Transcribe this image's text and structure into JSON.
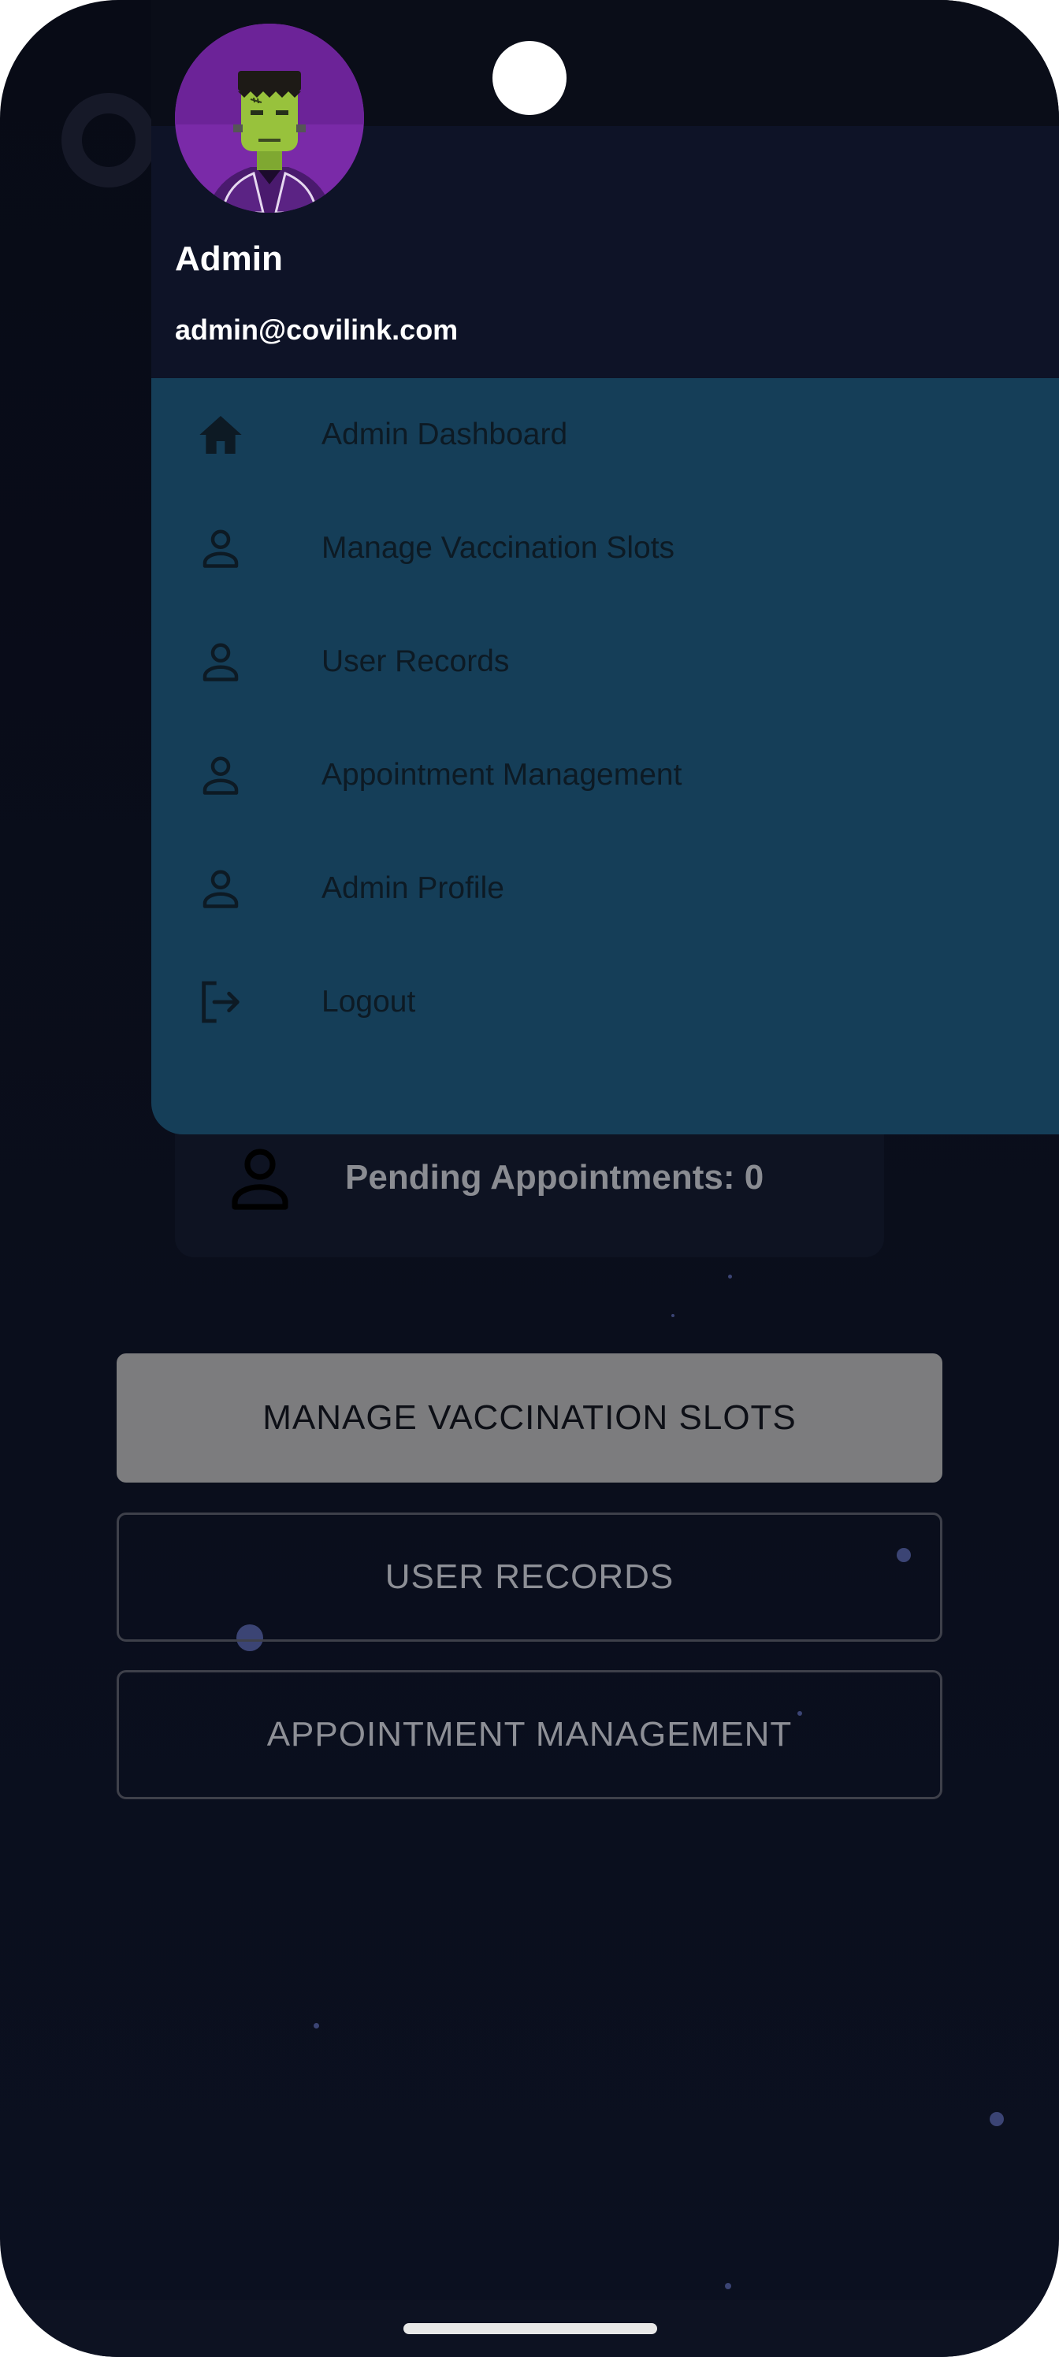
{
  "drawer": {
    "user": {
      "name": "Admin",
      "email": "admin@covilink.com",
      "avatar_icon": "frankenstein-avatar-icon"
    },
    "menu": [
      {
        "label": "Admin Dashboard",
        "icon": "home-icon"
      },
      {
        "label": "Manage Vaccination Slots",
        "icon": "person-icon"
      },
      {
        "label": "User Records",
        "icon": "person-icon"
      },
      {
        "label": "Appointment Management",
        "icon": "person-icon"
      },
      {
        "label": "Admin Profile",
        "icon": "person-icon"
      },
      {
        "label": "Logout",
        "icon": "logout-icon"
      }
    ]
  },
  "main": {
    "pending_label": "Pending Appointments: 0",
    "buttons": {
      "manage_slots": "MANAGE VACCINATION SLOTS",
      "user_records": "USER RECORDS",
      "appointment_management": "APPOINTMENT MANAGEMENT"
    }
  },
  "colors": {
    "background": "#080b16",
    "drawer_menu": "#153e58",
    "drawer_header": "#0e1327",
    "avatar": "#7a2aa8",
    "filled_button": "#7c7c7e"
  }
}
